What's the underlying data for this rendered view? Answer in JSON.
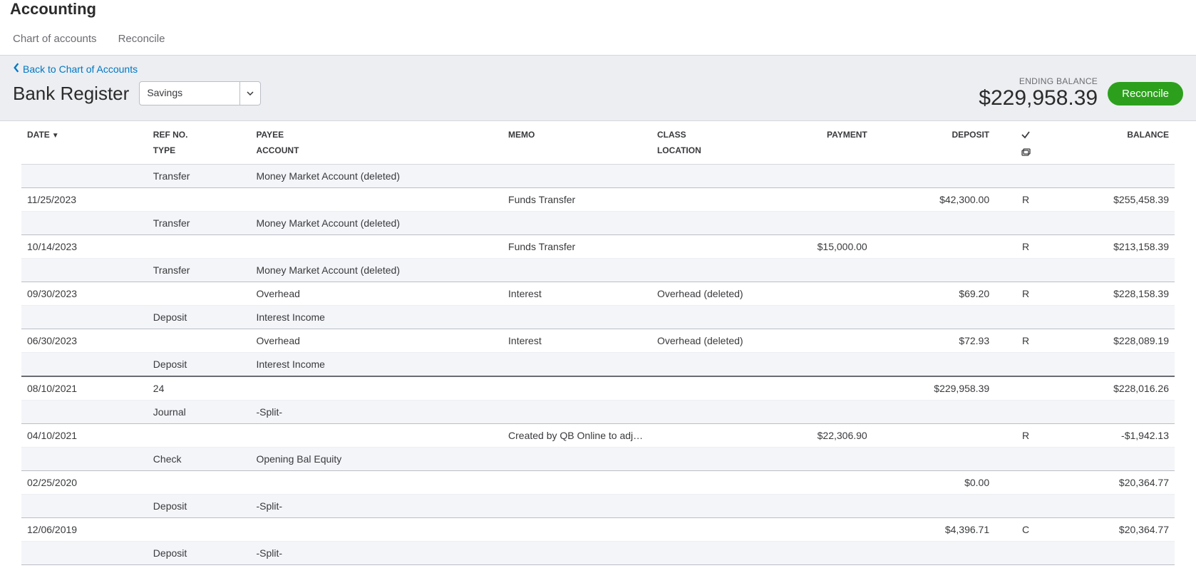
{
  "page": {
    "title": "Accounting"
  },
  "tabs": {
    "chart": "Chart of accounts",
    "reconcile": "Reconcile"
  },
  "toolbar": {
    "back_label": "Back to Chart of Accounts",
    "register_title": "Bank Register",
    "account_selected": "Savings",
    "ending_label": "ENDING BALANCE",
    "ending_value": "$229,958.39",
    "reconcile_button": "Reconcile"
  },
  "columns": {
    "date": "DATE",
    "ref": "REF NO.",
    "type": "TYPE",
    "payee": "PAYEE",
    "account": "ACCOUNT",
    "memo": "MEMO",
    "class": "CLASS",
    "location": "LOCATION",
    "payment": "PAYMENT",
    "deposit": "DEPOSIT",
    "balance": "BALANCE"
  },
  "rows": [
    {
      "date": "",
      "ref": "",
      "type": "Transfer",
      "payee": "",
      "account": "Money Market Account (deleted)",
      "memo": "",
      "class": "",
      "payment": "",
      "deposit": "",
      "rec": "",
      "balance": "",
      "account_link": false,
      "top_only_sep": true
    },
    {
      "date": "11/25/2023",
      "ref": "",
      "type": "Transfer",
      "payee": "",
      "account": "Money Market Account (deleted)",
      "memo": "Funds Transfer",
      "class": "",
      "payment": "",
      "deposit": "$42,300.00",
      "rec": "R",
      "balance": "$255,458.39",
      "account_link": false
    },
    {
      "date": "10/14/2023",
      "ref": "",
      "type": "Transfer",
      "payee": "",
      "account": "Money Market Account (deleted)",
      "memo": "Funds Transfer",
      "class": "",
      "payment": "$15,000.00",
      "deposit": "",
      "rec": "R",
      "balance": "$213,158.39",
      "account_link": false
    },
    {
      "date": "09/30/2023",
      "ref": "",
      "type": "Deposit",
      "payee": "Overhead",
      "account": "Interest Income",
      "memo": "Interest",
      "class": "Overhead (deleted)",
      "payment": "",
      "deposit": "$69.20",
      "rec": "R",
      "balance": "$228,158.39",
      "account_link": false
    },
    {
      "date": "06/30/2023",
      "ref": "",
      "type": "Deposit",
      "payee": "Overhead",
      "account": "Interest Income",
      "memo": "Interest",
      "class": "Overhead (deleted)",
      "payment": "",
      "deposit": "$72.93",
      "rec": "R",
      "balance": "$228,089.19",
      "account_link": false,
      "big_sep": true
    },
    {
      "date": "08/10/2021",
      "ref": "24",
      "type": "Journal",
      "payee": "",
      "account": "-Split-",
      "memo": "",
      "class": "",
      "payment": "",
      "deposit": "$229,958.39",
      "rec": "",
      "balance": "$228,016.26",
      "account_link": true
    },
    {
      "date": "04/10/2021",
      "ref": "",
      "type": "Check",
      "payee": "",
      "account": "Opening Bal Equity",
      "memo": "Created by QB Online to adjus…",
      "class": "",
      "payment": "$22,306.90",
      "deposit": "",
      "rec": "R",
      "balance": "-$1,942.13",
      "balance_neg": true,
      "account_link": false
    },
    {
      "date": "02/25/2020",
      "ref": "",
      "type": "Deposit",
      "payee": "",
      "account": "-Split-",
      "memo": "",
      "class": "",
      "payment": "",
      "deposit": "$0.00",
      "rec": "",
      "balance": "$20,364.77",
      "account_link": true
    },
    {
      "date": "12/06/2019",
      "ref": "",
      "type": "Deposit",
      "payee": "",
      "account": "-Split-",
      "memo": "",
      "class": "",
      "payment": "",
      "deposit": "$4,396.71",
      "rec": "C",
      "balance": "$20,364.77",
      "account_link": true
    }
  ]
}
